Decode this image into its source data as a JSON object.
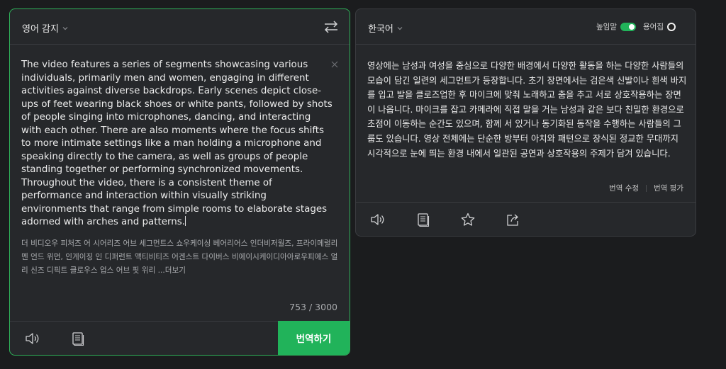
{
  "source": {
    "language_label": "영어 감지",
    "text": "The video features a series of segments showcasing various individuals, primarily men and women, engaging in different activities against diverse backdrops. Early scenes depict close-ups of feet wearing black shoes or white pants, followed by shots of people singing into microphones, dancing, and interacting with each other. There are also moments where the focus shifts to more intimate settings like a man holding a microphone and speaking directly to the camera, as well as groups of people standing together or performing synchronized movements. Throughout the video, there is a consistent theme of performance and interaction within visually striking environments that range from simple rooms to elaborate stages adorned with arches and patterns.",
    "pronunciation": "더 비디오우 피처즈 어 시어리즈 어브 세그먼트스 쇼우케이싱 베어리어스 인더비저월즈, 프라이메럴리 멘 언드 위먼, 인게이징 인 디퍼런트 액티비티즈 어겐스트 다이버스 비에이시케이디아아로우피에스 얼리 신즈 디픽트 클로우스 업스 어브 핏 위리 ...",
    "pronunciation_more": "더보기",
    "char_count": "753 / 3000",
    "translate_button": "번역하기"
  },
  "target": {
    "language_label": "한국어",
    "honorific_label": "높임말",
    "honorific_on": true,
    "glossary_label": "용어집",
    "glossary_on": false,
    "text": "영상에는 남성과 여성을 중심으로 다양한 배경에서 다양한 활동을 하는 다양한 사람들의 모습이 담긴 일련의 세그먼트가 등장합니다. 초기 장면에서는 검은색 신발이나 흰색 바지를 입고 발을 클로즈업한 후 마이크에 맞춰 노래하고 춤을 추고 서로 상호작용하는 장면이 나옵니다. 마이크를 잡고 카메라에 직접 말을 거는 남성과 같은 보다 친밀한 환경으로 초점이 이동하는 순간도 있으며, 함께 서 있거나 동기화된 동작을 수행하는 사람들의 그룹도 있습니다. 영상 전체에는 단순한 방부터 아치와 패턴으로 장식된 정교한 무대까지 시각적으로 눈에 띄는 환경 내에서 일관된 공연과 상호작용의 주제가 담겨 있습니다.",
    "edit_link": "번역 수정",
    "rate_link": "번역 평가"
  },
  "colors": {
    "accent": "#21b35a",
    "panel_bg": "#26282b",
    "page_bg": "#1b1c1e"
  },
  "icons": {
    "swap": "swap-arrows-icon",
    "clear": "close-icon",
    "speaker": "speaker-icon",
    "copy": "copy-icon",
    "favorite": "star-icon",
    "share": "share-icon"
  }
}
